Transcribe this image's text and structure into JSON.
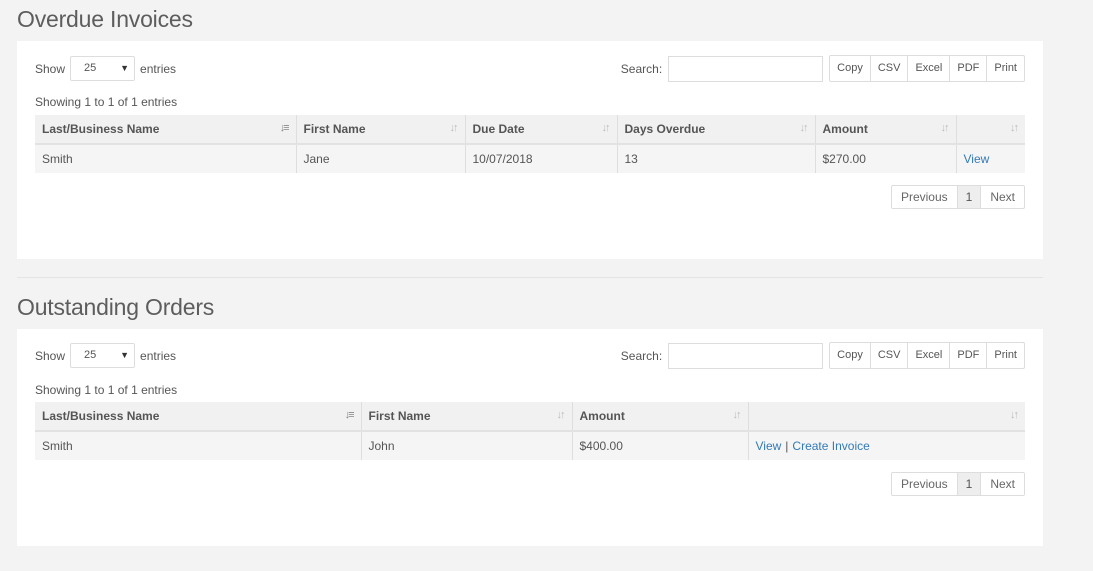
{
  "overdue": {
    "title": "Overdue Invoices",
    "show_label": "Show",
    "entries_label": "entries",
    "page_size": "25",
    "search_label": "Search:",
    "search_value": "",
    "buttons": [
      "Copy",
      "CSV",
      "Excel",
      "PDF",
      "Print"
    ],
    "info": "Showing 1 to 1 of 1 entries",
    "columns": [
      "Last/Business Name",
      "First Name",
      "Due Date",
      "Days Overdue",
      "Amount",
      ""
    ],
    "rows": [
      {
        "last": "Smith",
        "first": "Jane",
        "due": "10/07/2018",
        "days": "13",
        "amount": "$270.00",
        "action": "View"
      }
    ],
    "pager": {
      "prev": "Previous",
      "page": "1",
      "next": "Next"
    }
  },
  "orders": {
    "title": "Outstanding Orders",
    "show_label": "Show",
    "entries_label": "entries",
    "page_size": "25",
    "search_label": "Search:",
    "search_value": "",
    "buttons": [
      "Copy",
      "CSV",
      "Excel",
      "PDF",
      "Print"
    ],
    "info": "Showing 1 to 1 of 1 entries",
    "columns": [
      "Last/Business Name",
      "First Name",
      "Amount",
      ""
    ],
    "rows": [
      {
        "last": "Smith",
        "first": "John",
        "amount": "$400.00",
        "view": "View",
        "separator": "|",
        "create": "Create Invoice"
      }
    ],
    "pager": {
      "prev": "Previous",
      "page": "1",
      "next": "Next"
    }
  },
  "icons": {
    "sort": "sort-icon",
    "sort_active": "sort-alpha-asc-icon",
    "caret": "caret-down-icon"
  }
}
